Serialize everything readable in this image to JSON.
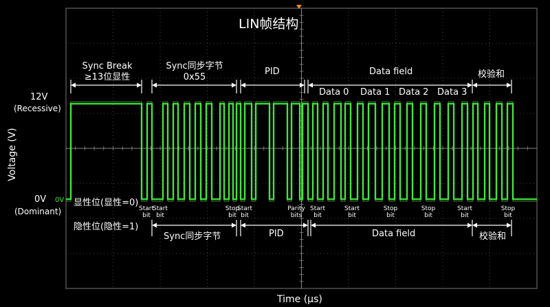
{
  "title": "LIN帧结构",
  "axes": {
    "ylabel": "Voltage (V)",
    "xlabel": "Time (µs)",
    "high_level": "12V",
    "high_name": "(Recessive)",
    "low_level": "0V",
    "low_name": "(Dominant)",
    "channel_marker": "0V"
  },
  "levels": {
    "dominant_line": "显性位(显性=0)",
    "recessive_line": "隐性位(隐性=1)"
  },
  "top_fields": {
    "sync_break_1": "Sync Break",
    "sync_break_2": "≥13位显性",
    "sync_1": "Sync同步字节",
    "sync_2": "0x55",
    "pid": "PID",
    "data_field": "Data field",
    "checksum": "校验和",
    "data0": "Data 0",
    "data1": "Data 1",
    "data2": "Data 2",
    "data3": "Data 3"
  },
  "bottom_fields": {
    "sync": "Sync同步字节",
    "pid": "PID",
    "data_field": "Data field",
    "checksum": "校验和"
  },
  "bit_labels": {
    "start": "Start",
    "stop": "Stop",
    "parity": "Parity",
    "bit": "bit",
    "bits": "bits"
  },
  "colors": {
    "background": "#000000",
    "grid": "#5a5a5a",
    "trace": "#39e639",
    "text": "#ffffff",
    "trigger_marker": "#f08a24"
  }
}
